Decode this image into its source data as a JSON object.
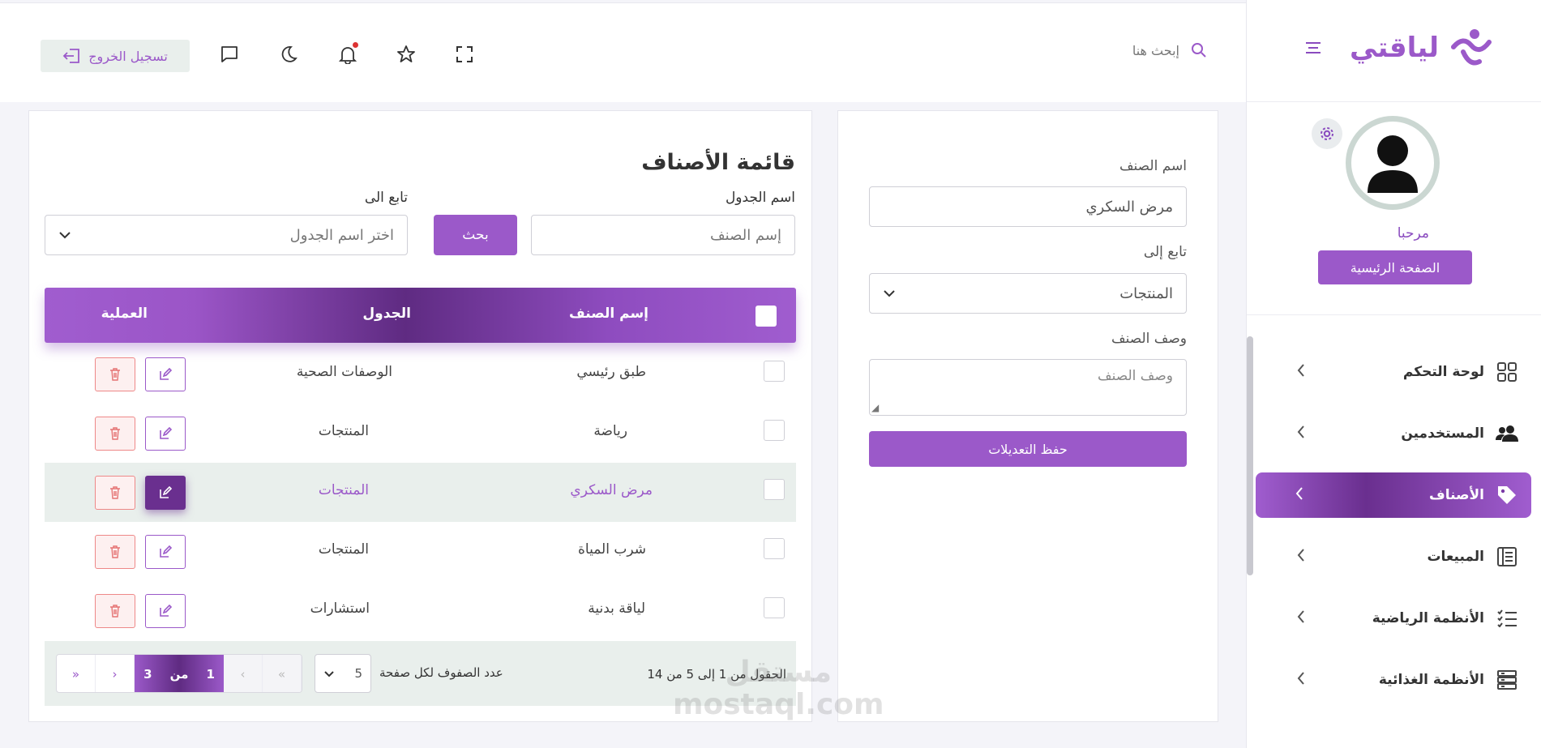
{
  "brand": {
    "name": "لياقتي",
    "accent": "#9b59c9",
    "accent_dark": "#5f2b82"
  },
  "header": {
    "search_placeholder": "إبحث هنا",
    "logout_label": "تسجيل الخروج",
    "icons": [
      "search-icon",
      "fullscreen-icon",
      "star-icon",
      "bell-icon",
      "moon-icon",
      "chat-icon",
      "logout-icon"
    ]
  },
  "sidebar": {
    "welcome": "مرحبا",
    "home_button": "الصفحة الرئيسية",
    "items": [
      {
        "label": "لوحة التحكم",
        "icon": "grid-icon"
      },
      {
        "label": "المستخدمين",
        "icon": "users-icon"
      },
      {
        "label": "الأصناف",
        "icon": "tag-icon",
        "active": true
      },
      {
        "label": "المبيعات",
        "icon": "receipt-icon"
      },
      {
        "label": "الأنظمة الرياضية",
        "icon": "list-icon"
      },
      {
        "label": "الأنظمة الغذائية",
        "icon": "server-icon"
      }
    ]
  },
  "edit_form": {
    "name_label": "اسم الصنف",
    "name_value": "مرض السكري",
    "parent_label": "تابع إلى",
    "parent_value": "المنتجات",
    "desc_label": "وصف الصنف",
    "desc_placeholder": "وصف الصنف",
    "save_label": "حفظ التعديلات"
  },
  "list": {
    "title": "قائمة الأصناف",
    "table_name_label": "اسم الجدول",
    "search_placeholder": "إسم الصنف",
    "search_button": "بحث",
    "parent_label": "تابع الى",
    "parent_placeholder": "اختر اسم الجدول",
    "columns": {
      "name": "إسم الصنف",
      "table": "الجدول",
      "action": "العملية"
    },
    "rows": [
      {
        "name": "طبق رئيسي",
        "table": "الوصفات الصحية"
      },
      {
        "name": "رياضة",
        "table": "المنتجات"
      },
      {
        "name": "مرض السكري",
        "table": "المنتجات",
        "highlighted": true
      },
      {
        "name": "شرب المياة",
        "table": "المنتجات"
      },
      {
        "name": "لياقة بدنية",
        "table": "استشارات"
      }
    ],
    "pagination": {
      "info": "الحقول من 1 إلى 5 من 14",
      "rows_per_page_label": "عدد الصفوف لكل صفحة",
      "rows_per_page": "5",
      "current_page": "1",
      "of_label": "من",
      "total_pages": "3"
    }
  },
  "watermark": {
    "line1": "مستقل",
    "line2": "mostaql.com"
  }
}
